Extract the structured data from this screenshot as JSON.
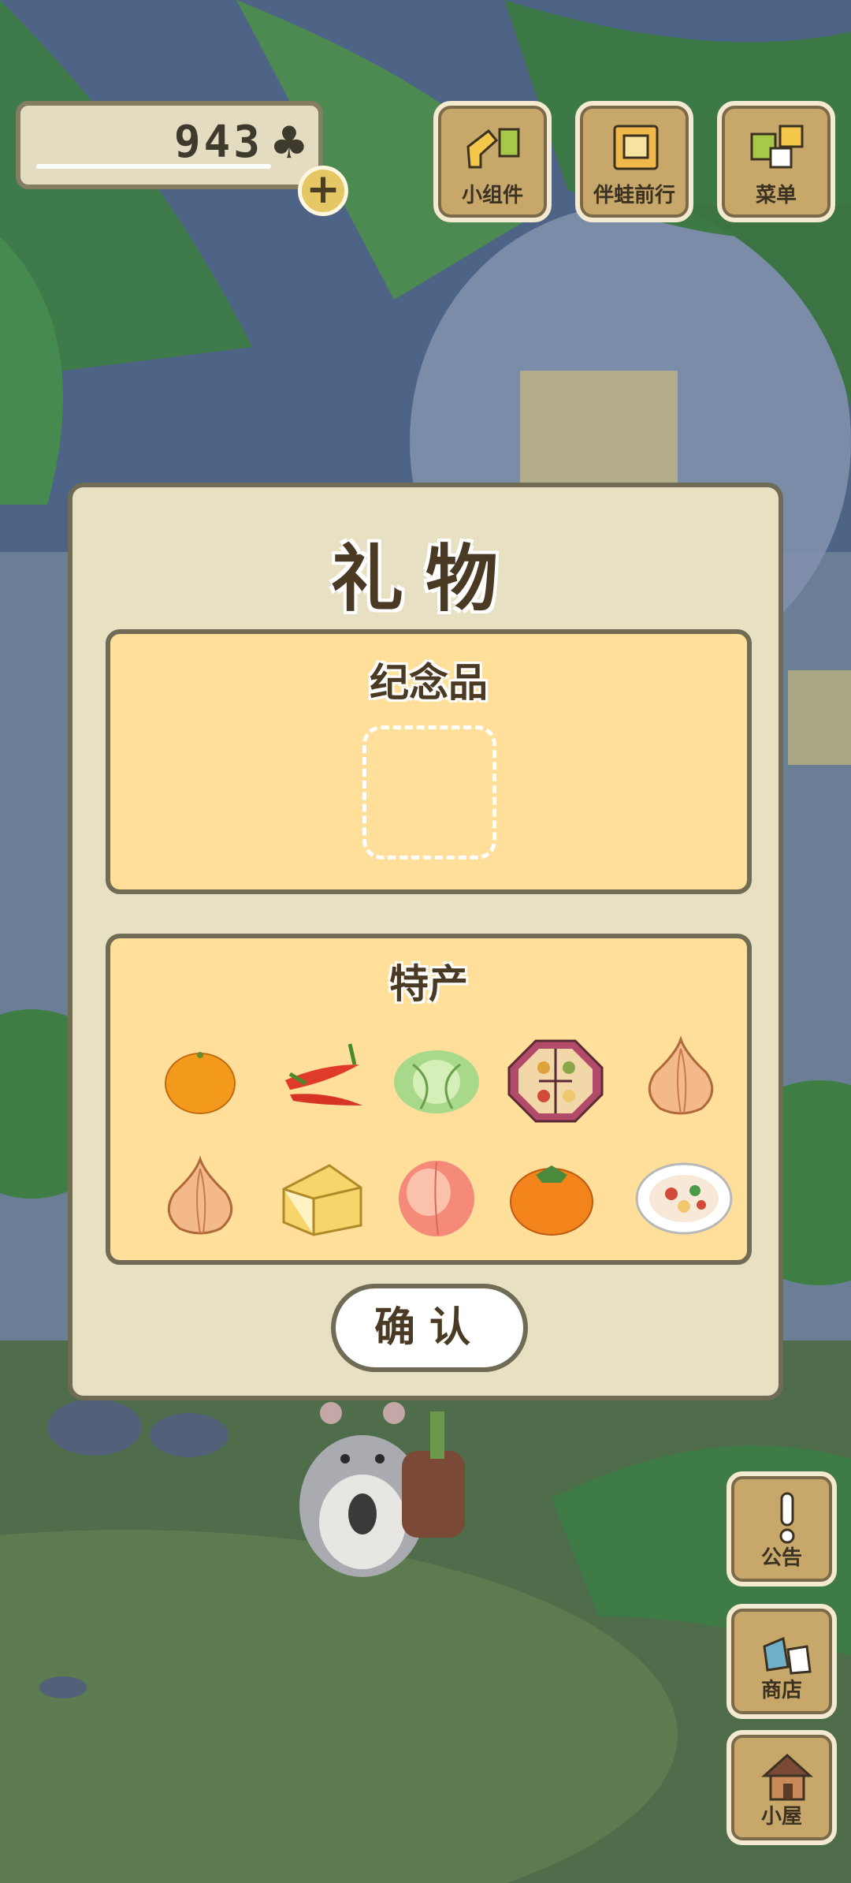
{
  "header": {
    "clover_count": "943",
    "clover_symbol": "♣",
    "plus_symbol": "+",
    "buttons": [
      {
        "label": "小组件",
        "icon": "widget-icon"
      },
      {
        "label": "伴蛙前行",
        "icon": "travel-book-icon"
      },
      {
        "label": "菜单",
        "icon": "menu-cards-icon"
      }
    ]
  },
  "side_buttons": [
    {
      "label": "公告",
      "icon": "exclamation-icon"
    },
    {
      "label": "商店",
      "icon": "shop-bags-icon"
    },
    {
      "label": "小屋",
      "icon": "house-icon"
    }
  ],
  "dialog": {
    "title": "礼物",
    "souvenir_title": "纪念品",
    "specialty_title": "特产",
    "specialty_items": [
      {
        "icon": "orange-icon"
      },
      {
        "icon": "chili-pepper-icon"
      },
      {
        "icon": "cabbage-icon"
      },
      {
        "icon": "bento-box-icon"
      },
      {
        "icon": "onion-icon"
      },
      {
        "icon": "onion-icon"
      },
      {
        "icon": "cheese-icon"
      },
      {
        "icon": "peach-icon"
      },
      {
        "icon": "persimmon-icon"
      },
      {
        "icon": "salad-plate-icon"
      }
    ],
    "confirm_label": "确认"
  },
  "colors": {
    "dialog_bg": "#e8e0c3",
    "panel_bg": "#ffdf9a",
    "border": "#6f6b55",
    "text_dark": "#4a3a24",
    "button_wood": "#c8a86a"
  }
}
